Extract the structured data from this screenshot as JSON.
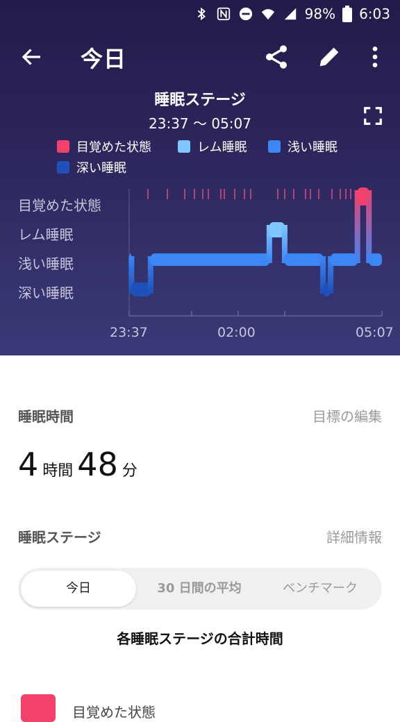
{
  "status": {
    "battery": "98%",
    "time": "6:03"
  },
  "appbar": {
    "title": "今日"
  },
  "chart": {
    "title": "睡眠ステージ",
    "range": "23:37 〜 05:07",
    "legend": [
      "目覚めた状態",
      "レム睡眠",
      "浅い睡眠",
      "深い睡眠"
    ],
    "y_labels": [
      "目覚めた状態",
      "レム睡眠",
      "浅い睡眠",
      "深い睡眠"
    ],
    "x_labels": [
      "23:37",
      "02:00",
      "05:07"
    ],
    "colors": {
      "awake": "#f2416b",
      "rem": "#7fc6ff",
      "light": "#3c86f5",
      "deep": "#1f4fb8"
    }
  },
  "chart_data": {
    "type": "area",
    "categories": [
      "深い睡眠",
      "浅い睡眠",
      "レム睡眠",
      "目覚めた状態"
    ],
    "x_start": "23:37",
    "x_end": "05:07",
    "segments": [
      {
        "start": "23:37",
        "end": "23:40",
        "stage": "浅い睡眠"
      },
      {
        "start": "23:40",
        "end": "00:05",
        "stage": "深い睡眠"
      },
      {
        "start": "00:05",
        "end": "02:40",
        "stage": "浅い睡眠"
      },
      {
        "start": "02:40",
        "end": "03:00",
        "stage": "レム睡眠"
      },
      {
        "start": "03:00",
        "end": "03:50",
        "stage": "浅い睡眠"
      },
      {
        "start": "03:50",
        "end": "04:00",
        "stage": "深い睡眠"
      },
      {
        "start": "04:00",
        "end": "04:35",
        "stage": "浅い睡眠"
      },
      {
        "start": "04:35",
        "end": "04:50",
        "stage": "目覚めた状態"
      },
      {
        "start": "04:50",
        "end": "05:07",
        "stage": "浅い睡眠"
      }
    ],
    "xlabel": "",
    "ylabel": ""
  },
  "sleep": {
    "title": "睡眠時間",
    "edit_goal": "目標の編集",
    "hours": "4",
    "hours_unit": "時間",
    "minutes": "48",
    "minutes_unit": "分"
  },
  "stages": {
    "title": "睡眠ステージ",
    "details": "詳細情報",
    "tabs": [
      "今日",
      "30 日間の平均",
      "ベンチマーク"
    ],
    "total_title": "各睡眠ステージの合計時間",
    "first_item": "目覚めた状態"
  }
}
